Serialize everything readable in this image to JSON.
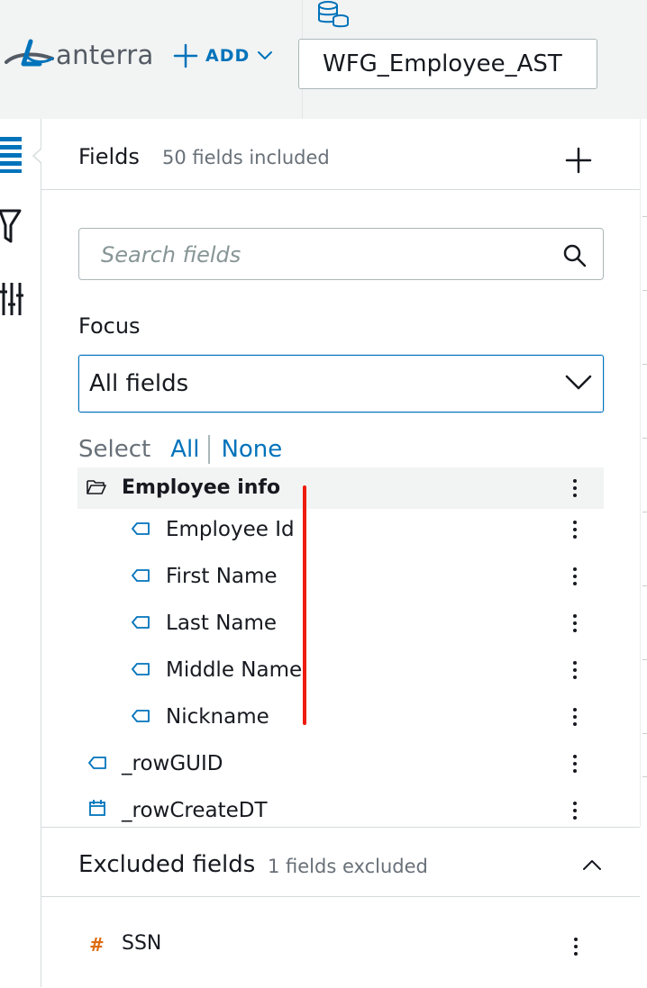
{
  "header": {
    "logo_text": "anterra",
    "add_label": "ADD",
    "dataset_name": "WFG_Employee_AST"
  },
  "fields_panel": {
    "title": "Fields",
    "count_text": "50 fields included",
    "search_placeholder": "Search fields",
    "focus_label": "Focus",
    "focus_value": "All fields",
    "select_label": "Select",
    "select_all": "All",
    "select_none": "None",
    "group": {
      "name": "Employee info"
    },
    "group_items": [
      {
        "name": "Employee Id",
        "type": "tag"
      },
      {
        "name": "First Name",
        "type": "tag"
      },
      {
        "name": "Last Name",
        "type": "tag"
      },
      {
        "name": "Middle Name",
        "type": "tag"
      },
      {
        "name": "Nickname",
        "type": "tag"
      }
    ],
    "root_items": [
      {
        "name": "_rowGUID",
        "type": "tag"
      },
      {
        "name": "_rowCreateDT",
        "type": "date"
      }
    ]
  },
  "excluded_panel": {
    "title": "Excluded fields",
    "count_text": "1 fields excluded",
    "items": [
      {
        "name": "SSN",
        "type": "number",
        "icon": "#"
      }
    ]
  },
  "colors": {
    "accent": "#0073bb",
    "text": "#16191f",
    "muted": "#687078",
    "number_icon": "#dd6b10",
    "annotation_line": "#ee1c0c"
  }
}
